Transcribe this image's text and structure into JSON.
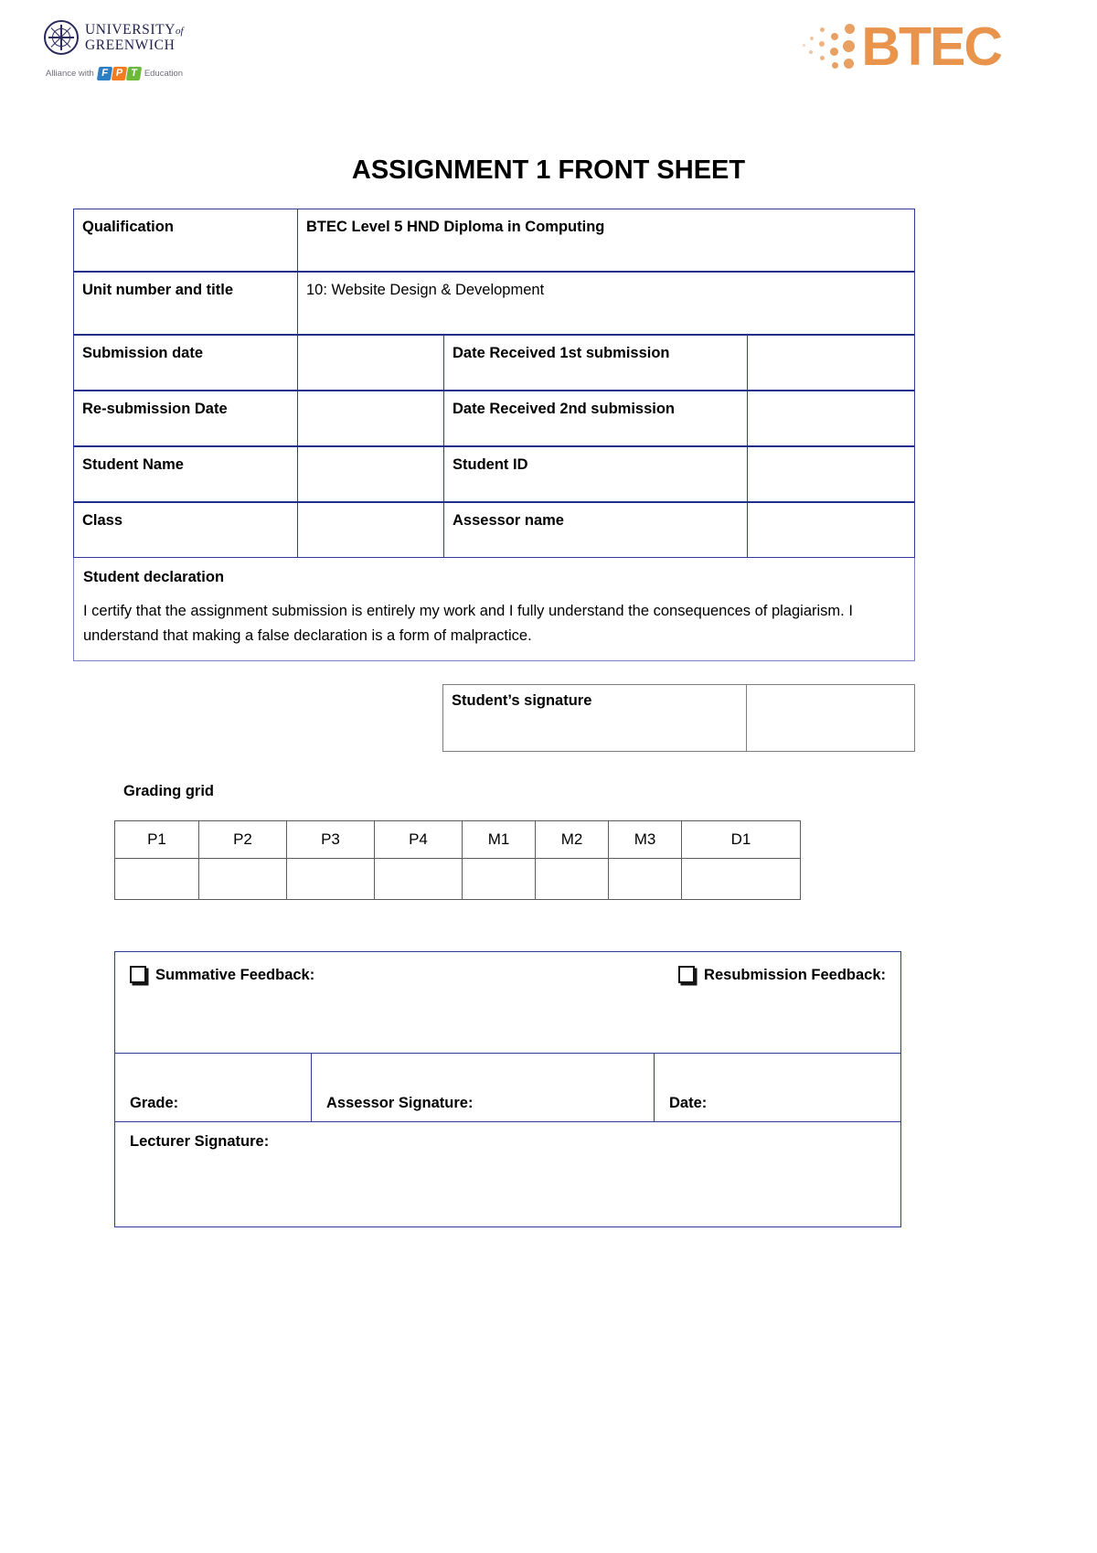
{
  "header": {
    "university": {
      "line1_main": "UNIVERSITY",
      "line1_of": "of",
      "line2": "GREENWICH",
      "alliance_prefix": "Alliance with",
      "fpt_letters": [
        "F",
        "P",
        "T"
      ],
      "alliance_suffix": "Education",
      "crest_icon": "compass-crest-icon"
    },
    "btec": {
      "wordmark": "BTEC",
      "dots_icon": "pixel-dots-icon",
      "color": "#e8944d"
    }
  },
  "title": "ASSIGNMENT 1 FRONT SHEET",
  "info_rows": [
    {
      "label": "Qualification",
      "value": "BTEC Level 5 HND Diploma in Computing",
      "value_bold": true
    },
    {
      "label": "Unit number and title",
      "value": "10: Website Design & Development",
      "value_bold": false
    },
    {
      "label": "Submission date",
      "value": "",
      "label2": "Date Received 1st submission",
      "value2": ""
    },
    {
      "label": "Re-submission Date",
      "value": "",
      "label2": "Date Received 2nd submission",
      "value2": ""
    },
    {
      "label": "Student Name",
      "value": "",
      "label2": "Student ID",
      "value2": ""
    },
    {
      "label": "Class",
      "value": "",
      "label2": "Assessor name",
      "value2": ""
    }
  ],
  "declaration": {
    "title": "Student declaration",
    "body": "I certify that the assignment submission is entirely my work and I fully understand the consequences of plagiarism. I understand that making a false declaration is a form of malpractice."
  },
  "signature_row": {
    "label": "Student’s signature",
    "value": ""
  },
  "grading": {
    "label": "Grading grid",
    "columns": [
      "P1",
      "P2",
      "P3",
      "P4",
      "M1",
      "M2",
      "M3",
      "D1"
    ],
    "values": [
      "",
      "",
      "",
      "",
      "",
      "",
      "",
      ""
    ]
  },
  "feedback": {
    "summative_label": "Summative Feedback:",
    "resubmission_label": "Resubmission Feedback:",
    "summative_checkbox_icon": "checkbox-icon",
    "resubmission_checkbox_icon": "checkbox-icon",
    "grade_label": "Grade:",
    "assessor_signature_label": "Assessor Signature:",
    "date_label": "Date:",
    "lecturer_signature_label": "Lecturer Signature:"
  },
  "colors": {
    "table_border": "#2f3b96",
    "btec_orange": "#e8944d",
    "uog_navy": "#21214d"
  }
}
